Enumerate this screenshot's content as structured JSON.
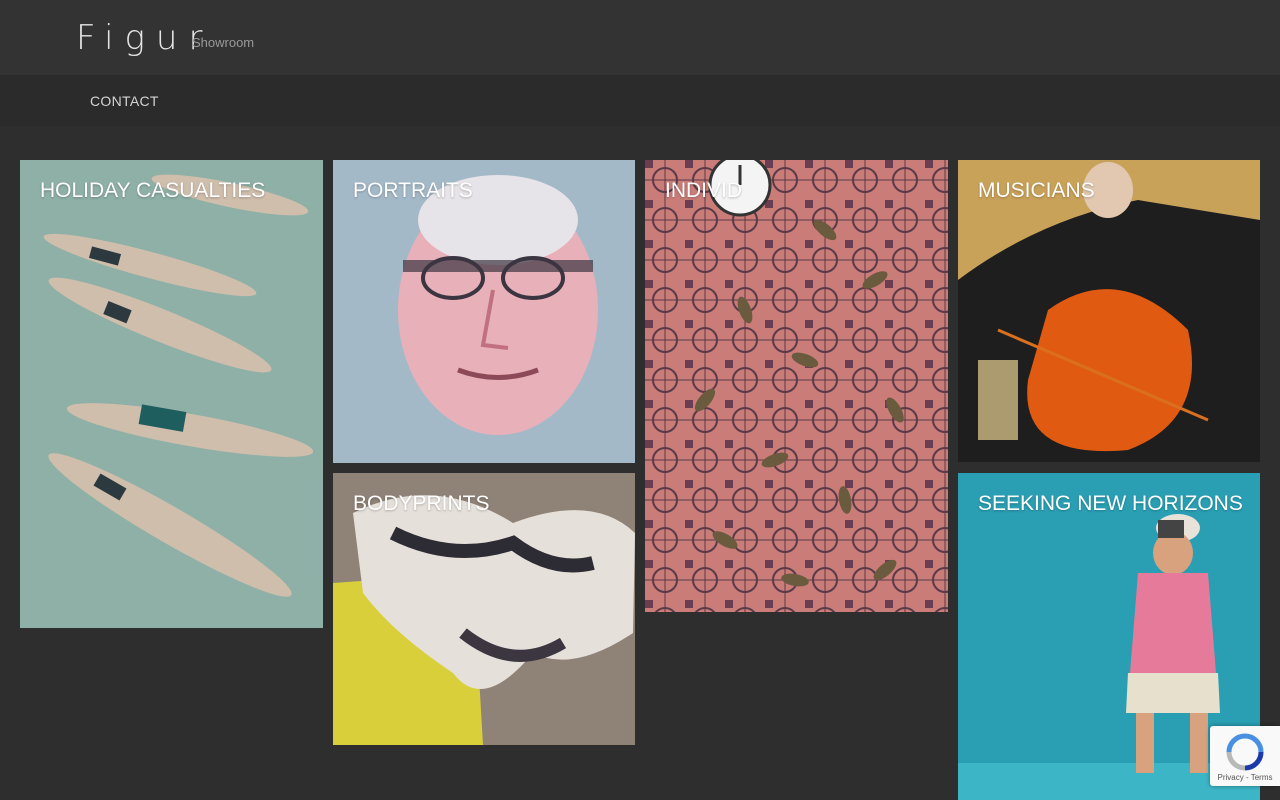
{
  "header": {
    "logo": "Figur",
    "tagline": "Showroom"
  },
  "nav": {
    "items": [
      {
        "label": "CONTACT"
      }
    ]
  },
  "gallery": {
    "tiles": [
      {
        "title": "HOLIDAY CASUALTIES"
      },
      {
        "title": "PORTRAITS"
      },
      {
        "title": "INDIVID"
      },
      {
        "title": "MUSICIANS"
      },
      {
        "title": "BODYPRINTS"
      },
      {
        "title": "SEEKING NEW HORIZONS"
      }
    ]
  },
  "recaptcha": {
    "links": "Privacy - Terms"
  },
  "colors": {
    "background": "#2e2e2e",
    "header": "#333333",
    "nav": "#2b2b2b"
  }
}
